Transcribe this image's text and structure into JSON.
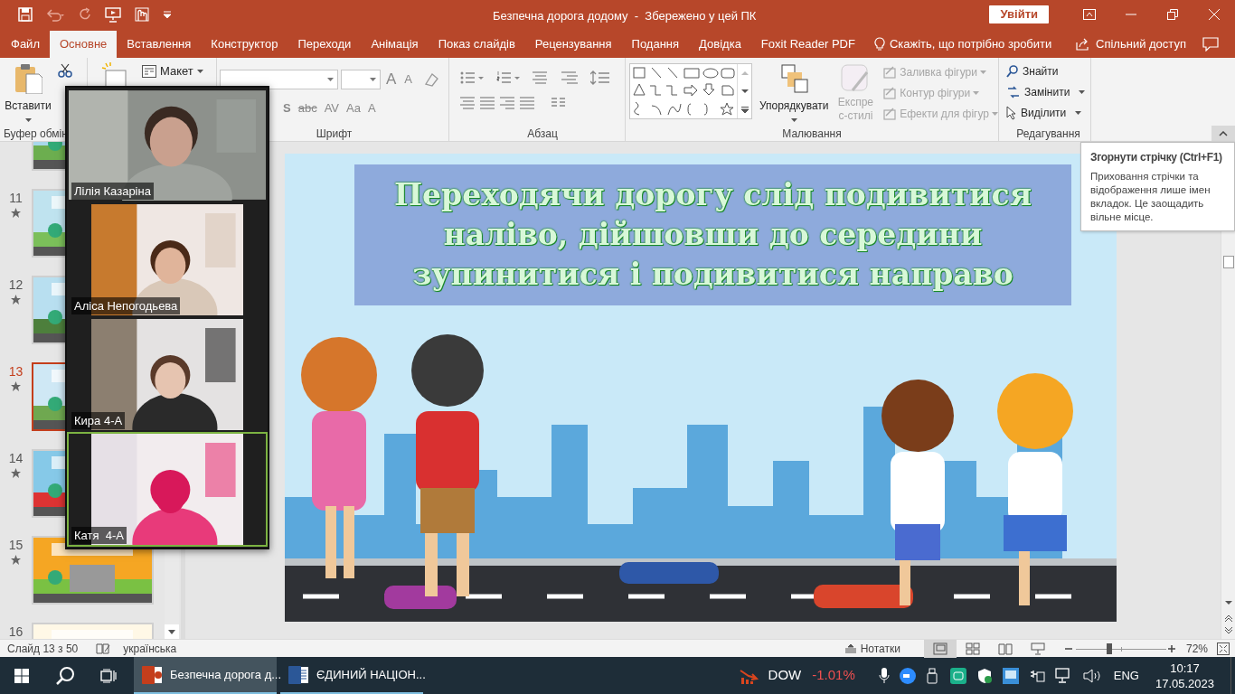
{
  "title_bar": {
    "title": "Безпечна дорога додому  -  Збережено у цей ПК",
    "sign_in": "Увійти"
  },
  "tabs": [
    {
      "label": "Файл",
      "selected": false
    },
    {
      "label": "Основне",
      "selected": true
    },
    {
      "label": "Вставлення",
      "selected": false
    },
    {
      "label": "Конструктор",
      "selected": false
    },
    {
      "label": "Переходи",
      "selected": false
    },
    {
      "label": "Анімація",
      "selected": false
    },
    {
      "label": "Показ слайдів",
      "selected": false
    },
    {
      "label": "Рецензування",
      "selected": false
    },
    {
      "label": "Подання",
      "selected": false
    },
    {
      "label": "Довідка",
      "selected": false
    },
    {
      "label": "Foxit Reader PDF",
      "selected": false
    }
  ],
  "tell_me": "Скажіть, що потрібно зробити",
  "share": "Спільний доступ",
  "ribbon": {
    "paste": "Вставити",
    "clipboard_group": "Буфер обмін",
    "layout": "Макет",
    "font_grow_shrink": [
      "A",
      "A"
    ],
    "font_tools": [
      "S",
      "abc",
      "AV",
      "Aa",
      "A"
    ],
    "font_group": "Шрифт",
    "paragraph_group": "Абзац",
    "arrange": {
      "label": "Упорядкувати",
      "disabled": false
    },
    "quick_styles": {
      "label": "Експрес-стилі",
      "disabled": true
    },
    "shape_commands": [
      {
        "label": "Заливка фігури",
        "disabled": true
      },
      {
        "label": "Контур фігури",
        "disabled": true
      },
      {
        "label": "Ефекти для фігур",
        "disabled": true
      }
    ],
    "drawing_group": "Малювання",
    "editing": [
      "Знайти",
      "Замінити",
      "Виділити"
    ],
    "editing_group": "Редагування"
  },
  "tooltip": {
    "title": "Згорнути стрічку (Ctrl+F1)",
    "body": "Приховання стрічки та відображення лише імен вкладок. Це заощадить вільне місце."
  },
  "thumbnails": [
    {
      "number": "11",
      "selected": false,
      "animated": true
    },
    {
      "number": "12",
      "selected": false,
      "animated": true
    },
    {
      "number": "13",
      "selected": true,
      "animated": true
    },
    {
      "number": "14",
      "selected": false,
      "animated": true
    },
    {
      "number": "15",
      "selected": false,
      "animated": true
    },
    {
      "number": "16",
      "selected": false
    }
  ],
  "slide": {
    "title": "Переходячи дорогу слід подивитися наліво, дійшовши до середини зупинитися і подивитися направо"
  },
  "video_call": [
    {
      "name": "Лілія Казаріна",
      "speaking": false
    },
    {
      "name": "Аліса Непогодьева",
      "speaking": false
    },
    {
      "name": "Кира 4-А",
      "speaking": false
    },
    {
      "name": "Катя  4-А",
      "speaking": true
    }
  ],
  "status_bar": {
    "slide_counter": "Слайд 13 з 50",
    "language": "українська",
    "notes": "Нотатки",
    "zoom": "72%",
    "zoom_slider": {
      "level": 0.36
    },
    "views": [
      {
        "selected": true
      },
      {
        "selected": false
      },
      {
        "selected": false
      },
      {
        "selected": false
      }
    ]
  },
  "taskbar": {
    "apps": [
      {
        "label": "Безпечна дорога д...",
        "kind": "powerpoint",
        "selected": true
      },
      {
        "label": "ЄДИНИЙ НАЦІОН...",
        "kind": "word",
        "selected": false
      }
    ],
    "ticker": "DOW",
    "change": "-1.01%",
    "language": "ENG",
    "time": "10:17",
    "date": "17.05.2023"
  }
}
